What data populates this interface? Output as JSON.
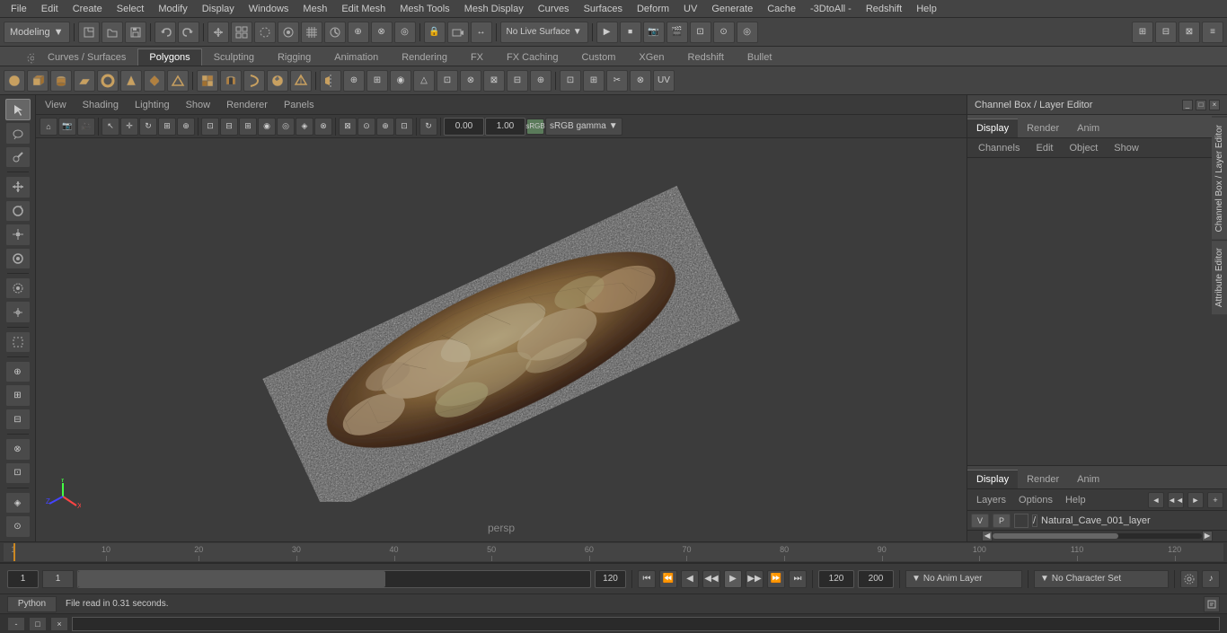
{
  "app": {
    "title": "Autodesk Maya"
  },
  "menubar": {
    "items": [
      {
        "id": "file",
        "label": "File"
      },
      {
        "id": "edit",
        "label": "Edit"
      },
      {
        "id": "create",
        "label": "Create"
      },
      {
        "id": "select",
        "label": "Select"
      },
      {
        "id": "modify",
        "label": "Modify"
      },
      {
        "id": "display",
        "label": "Display"
      },
      {
        "id": "windows",
        "label": "Windows"
      },
      {
        "id": "mesh",
        "label": "Mesh"
      },
      {
        "id": "edit-mesh",
        "label": "Edit Mesh"
      },
      {
        "id": "mesh-tools",
        "label": "Mesh Tools"
      },
      {
        "id": "mesh-display",
        "label": "Mesh Display"
      },
      {
        "id": "curves",
        "label": "Curves"
      },
      {
        "id": "surfaces",
        "label": "Surfaces"
      },
      {
        "id": "deform",
        "label": "Deform"
      },
      {
        "id": "uv",
        "label": "UV"
      },
      {
        "id": "generate",
        "label": "Generate"
      },
      {
        "id": "cache",
        "label": "Cache"
      },
      {
        "id": "3dtoa",
        "label": "-3DtoAll -"
      },
      {
        "id": "redshift",
        "label": "Redshift"
      },
      {
        "id": "help",
        "label": "Help"
      }
    ]
  },
  "mode_dropdown": {
    "value": "Modeling",
    "label": "Modeling"
  },
  "workflow_tabs": {
    "items": [
      {
        "id": "curves-surfaces",
        "label": "Curves / Surfaces",
        "active": false
      },
      {
        "id": "polygons",
        "label": "Polygons",
        "active": true
      },
      {
        "id": "sculpting",
        "label": "Sculpting",
        "active": false
      },
      {
        "id": "rigging",
        "label": "Rigging",
        "active": false
      },
      {
        "id": "animation",
        "label": "Animation",
        "active": false
      },
      {
        "id": "rendering",
        "label": "Rendering",
        "active": false
      },
      {
        "id": "fx",
        "label": "FX",
        "active": false
      },
      {
        "id": "fx-caching",
        "label": "FX Caching",
        "active": false
      },
      {
        "id": "custom",
        "label": "Custom",
        "active": false
      },
      {
        "id": "xgen",
        "label": "XGen",
        "active": false
      },
      {
        "id": "redshift",
        "label": "Redshift",
        "active": false
      },
      {
        "id": "bullet",
        "label": "Bullet",
        "active": false
      }
    ]
  },
  "viewport": {
    "camera": "persp",
    "menu_items": [
      "View",
      "Shading",
      "Lighting",
      "Show",
      "Renderer",
      "Panels"
    ],
    "value_display": "0.00",
    "value_display2": "1.00",
    "color_space": "sRGB gamma",
    "live_surface": "No Live Surface"
  },
  "channel_box": {
    "title": "Channel Box / Layer Editor",
    "tabs": [
      {
        "id": "display",
        "label": "Display",
        "active": true
      },
      {
        "id": "render",
        "label": "Render",
        "active": false
      },
      {
        "id": "anim",
        "label": "Anim",
        "active": false
      }
    ],
    "menu_items": [
      "Channels",
      "Edit",
      "Object",
      "Show"
    ]
  },
  "layers": {
    "title": "Layers",
    "tabs": [
      {
        "id": "display",
        "label": "Display",
        "active": true
      },
      {
        "id": "render",
        "label": "Render",
        "active": false
      },
      {
        "id": "anim",
        "label": "Anim",
        "active": false
      }
    ],
    "menu_items": [
      "Layers",
      "Options",
      "Help"
    ],
    "items": [
      {
        "v": "V",
        "p": "P",
        "name": "Natural_Cave_001_layer",
        "color": "#3c3c3c"
      }
    ]
  },
  "timeline": {
    "start": 1,
    "end": 120,
    "current": 1,
    "ticks": [
      1,
      10,
      20,
      30,
      40,
      50,
      60,
      70,
      80,
      90,
      100,
      110,
      120
    ]
  },
  "playback": {
    "current_frame": "1",
    "start_frame": "1",
    "end_frame": "120",
    "range_start": "120",
    "range_end": "200",
    "buttons": [
      "⏮",
      "⏪",
      "◀",
      "▶",
      "▶▶",
      "⏭",
      "⏭⏭"
    ]
  },
  "anim_layer": {
    "label": "No Anim Layer",
    "dropdown_arrow": "▼"
  },
  "char_set": {
    "label": "No Character Set",
    "dropdown_arrow": "▼"
  },
  "status_bar": {
    "python_label": "Python",
    "message": "File read in  0.31 seconds."
  },
  "right_labels": [
    {
      "id": "channel-box-label",
      "label": "Channel Box / Layer Editor"
    },
    {
      "id": "attribute-editor-label",
      "label": "Attribute Editor"
    }
  ],
  "left_tools": [
    {
      "id": "select",
      "icon": "↖",
      "title": "Select Tool"
    },
    {
      "id": "lasso",
      "icon": "⊛",
      "title": "Lasso Select"
    },
    {
      "id": "paint",
      "icon": "✎",
      "title": "Paint Selection"
    },
    {
      "id": "move",
      "icon": "✛",
      "title": "Move Tool"
    },
    {
      "id": "rotate",
      "icon": "↻",
      "title": "Rotate Tool"
    },
    {
      "id": "scale",
      "icon": "⊞",
      "title": "Scale Tool"
    },
    {
      "id": "last-tool",
      "icon": "▣",
      "title": "Last Tool"
    },
    {
      "id": "soft-sel",
      "icon": "◉",
      "title": "Soft Select"
    },
    {
      "id": "show-manip",
      "icon": "⌖",
      "title": "Show Manipulator"
    },
    {
      "id": "marquee",
      "icon": "⊡",
      "title": "Marquee Select"
    },
    {
      "id": "extra1",
      "icon": "⊕",
      "title": "Extra Tool 1"
    },
    {
      "id": "extra2",
      "icon": "⊖",
      "title": "Extra Tool 2"
    },
    {
      "id": "mask",
      "icon": "⊗",
      "title": "Mask"
    },
    {
      "id": "view-cube",
      "icon": "◈",
      "title": "View Cube"
    },
    {
      "id": "snap",
      "icon": "⊙",
      "title": "Snap"
    }
  ]
}
